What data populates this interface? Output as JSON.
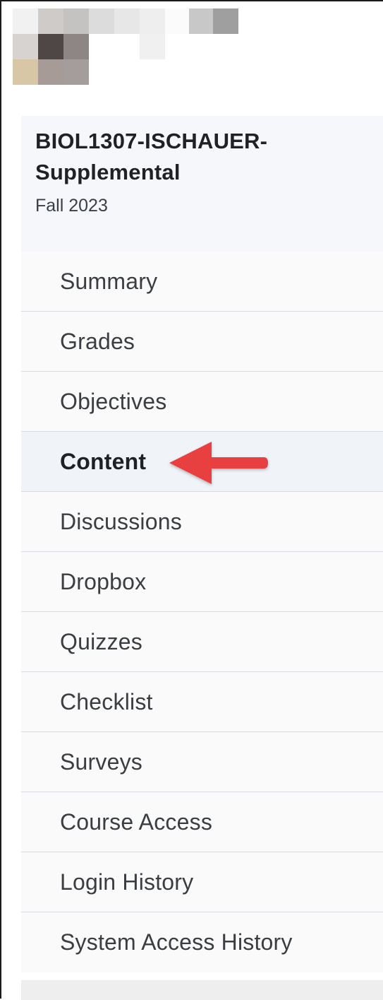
{
  "course": {
    "title": "BIOL1307-ISCHAUER-Supplemental",
    "term": "Fall 2023"
  },
  "nav": {
    "items": [
      {
        "label": "Summary"
      },
      {
        "label": "Grades"
      },
      {
        "label": "Objectives"
      },
      {
        "label": "Content"
      },
      {
        "label": "Discussions"
      },
      {
        "label": "Dropbox"
      },
      {
        "label": "Quizzes"
      },
      {
        "label": "Checklist"
      },
      {
        "label": "Surveys"
      },
      {
        "label": "Course Access"
      },
      {
        "label": "Login History"
      },
      {
        "label": "System Access History"
      }
    ],
    "active_label": "Content"
  },
  "colors": {
    "arrow": "#e8403f",
    "active_bg": "#f0f4f8",
    "header_bg": "#f5f7fb",
    "divider": "#d8dbe2"
  },
  "icons": {
    "avatar": "user-avatar-blurred",
    "annotation": "red-arrow-pointing-left"
  }
}
